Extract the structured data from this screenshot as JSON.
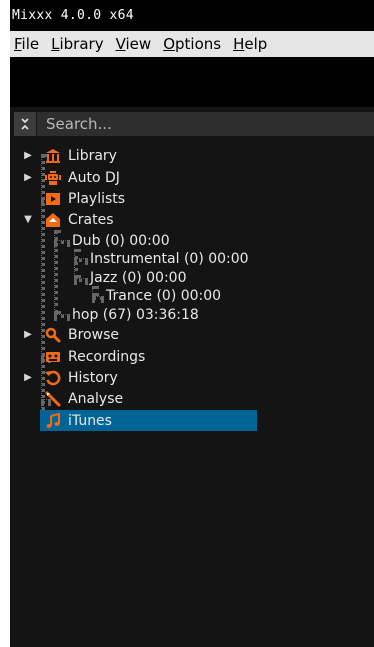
{
  "window": {
    "title": "Mixxx 4.0.0 x64"
  },
  "menu": [
    {
      "first": "F",
      "rest": "ile"
    },
    {
      "first": "L",
      "rest": "ibrary"
    },
    {
      "first": "V",
      "rest": "iew"
    },
    {
      "first": "O",
      "rest": "ptions"
    },
    {
      "first": "H",
      "rest": "elp"
    }
  ],
  "search": {
    "placeholder": "Search..."
  },
  "sidebar": {
    "library": "Library",
    "autodj": "Auto DJ",
    "playlists": "Playlists",
    "crates": "Crates",
    "crate_dub": "Dub (0) 00:00",
    "crate_instrumental": "Instrumental (0) 00:00",
    "crate_jazz": "Jazz (0) 00:00",
    "crate_trance": "Trance (0) 00:00",
    "crate_hop": "hop (67) 03:36:18",
    "browse": "Browse",
    "recordings": "Recordings",
    "history": "History",
    "analyse": "Analyse",
    "itunes": "iTunes"
  },
  "colors": {
    "accent": "#f26b12",
    "selection": "#006596"
  }
}
